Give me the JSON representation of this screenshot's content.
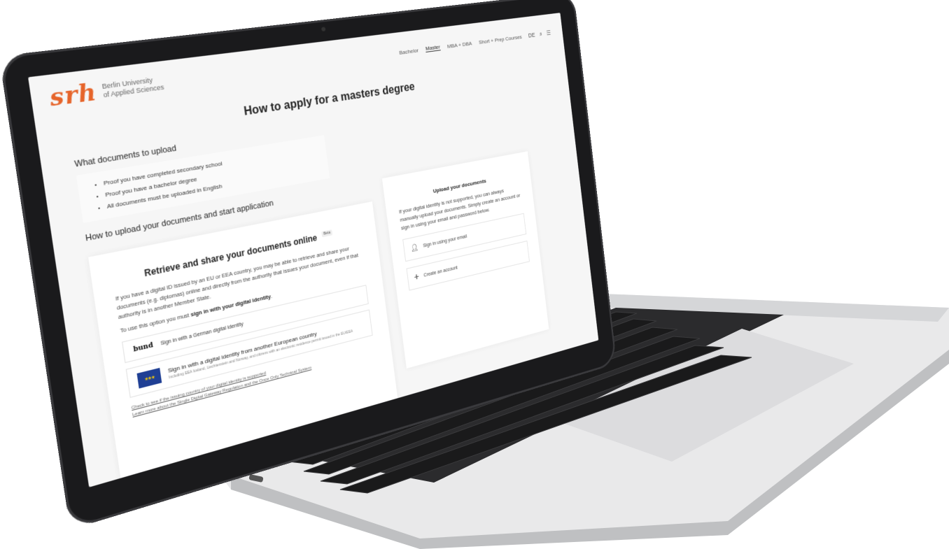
{
  "header": {
    "brand_mark": "srh",
    "brand_line1": "Berlin University",
    "brand_line2": "of Applied Sciences",
    "nav": [
      {
        "label": "Bachelor",
        "active": false
      },
      {
        "label": "Master",
        "active": true
      },
      {
        "label": "MBA + DBA",
        "active": false
      },
      {
        "label": "Short + Prep Courses",
        "active": false
      }
    ],
    "lang": "DE",
    "search_icon": "search-icon",
    "menu_icon": "menu-icon"
  },
  "page_title": "How to apply for a masters degree",
  "documents": {
    "title": "What documents to upload",
    "items": [
      "Proof you have completed secondary school",
      "Proof you have a bachelor degree",
      "All documents must be uploaded in English"
    ]
  },
  "upload_section": {
    "title": "How to upload your documents and start application"
  },
  "retrieve_card": {
    "title": "Retrieve and share your documents online",
    "badge": "Beta",
    "text": "If you have a digital ID issued by an EU or EEA country, you may be able to retrieve and share your documents (e.g. diplomas) online and directly from the authority that issues your document, even if that authority is in another Member State.",
    "instruction_prefix": "To use this option you must ",
    "instruction_strong": "sign in with your digital identity",
    "instruction_suffix": ".",
    "bund_logo": "bund",
    "bund_label": "Sign in with a German digital identity",
    "eu_main": "Sign in with a digital identity from another European country",
    "eu_sub": "Including EEA Iceland, Liechtenstein and Norway, and citizens with an electronic residence permit issued in the EU/EEA",
    "link_1": "Check to see if the issuing country of your digital identity is supported",
    "link_2": "Learn more about the Single Digital Gateway Regulation and the Once Only Technical System"
  },
  "upload_card": {
    "title": "Upload your documents",
    "text": "If your digital identity is not supported, you can always manually upload your documents. Simply create an account or sign in using your email and password below.",
    "option_email": "Sign in using your email",
    "option_create": "Create an account"
  },
  "colors": {
    "brand_accent": "#e6642a",
    "eu_blue": "#1f3f94",
    "eu_star": "#ffd200"
  }
}
